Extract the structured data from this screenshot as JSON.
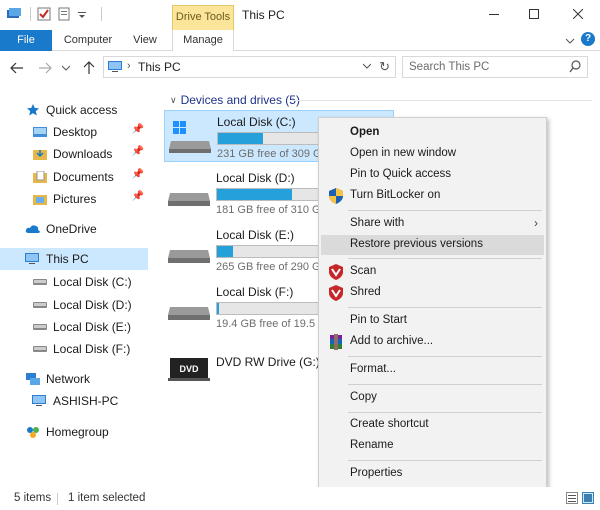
{
  "window": {
    "title": "This PC",
    "context_tab": "Drive Tools",
    "controls": [
      "minimize-icon",
      "maximize-icon",
      "close-icon"
    ]
  },
  "ribbon": {
    "tabs": [
      "File",
      "Computer",
      "View",
      "Manage"
    ]
  },
  "address": {
    "path": "This PC",
    "search_placeholder": "Search This PC"
  },
  "nav": {
    "quick_access": "Quick access",
    "pinned": [
      "Desktop",
      "Downloads",
      "Documents",
      "Pictures"
    ],
    "onedrive": "OneDrive",
    "this_pc": "This PC",
    "drives": [
      "Local Disk (C:)",
      "Local Disk (D:)",
      "Local Disk (E:)",
      "Local Disk (F:)"
    ],
    "network": "Network",
    "network_pc": "ASHISH-PC",
    "homegroup": "Homegroup"
  },
  "content": {
    "group_header": "Devices and drives (5)",
    "drives": [
      {
        "name": "Local Disk (C:)",
        "free": "231 GB free of 309 G",
        "used_fraction": 0.25
      },
      {
        "name": "Local Disk (D:)",
        "free": "181 GB free of 310 G",
        "used_fraction": 0.42
      },
      {
        "name": "Local Disk (E:)",
        "free": "265 GB free of 290 G",
        "used_fraction": 0.09
      },
      {
        "name": "Local Disk (F:)",
        "free": "19.4 GB free of 19.5 G",
        "used_fraction": 0.01
      },
      {
        "name": "DVD RW Drive (G:)"
      }
    ]
  },
  "context_menu": {
    "items": [
      "Open",
      "Open in new window",
      "Pin to Quick access",
      "Turn BitLocker on",
      "Share with",
      "Restore previous versions",
      "Scan",
      "Shred",
      "Pin to Start",
      "Add to archive...",
      "Format...",
      "Copy",
      "Create shortcut",
      "Rename",
      "Properties"
    ]
  },
  "status": {
    "items_count": "5 items",
    "selected": "1 item selected"
  },
  "colors": {
    "accent": "#1979ca",
    "selection": "#cce8ff",
    "drive_bar": "#26a0da",
    "context_tab": "#fbe59b"
  }
}
